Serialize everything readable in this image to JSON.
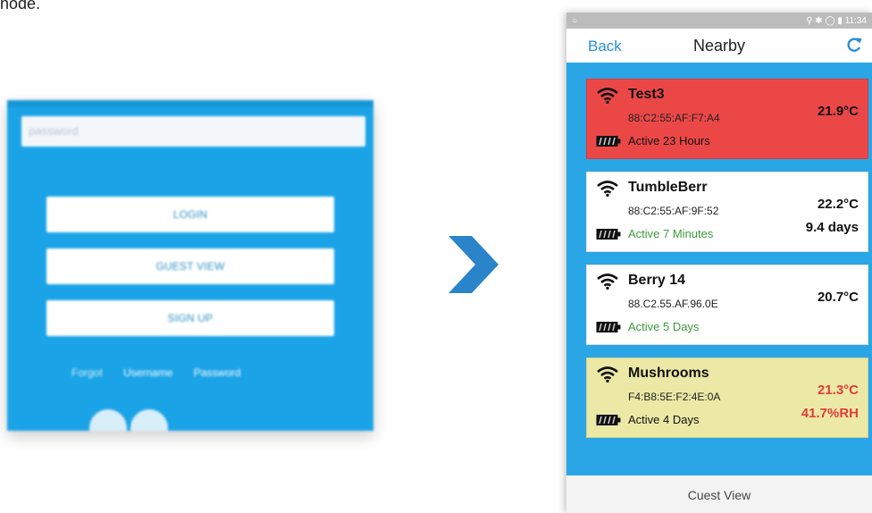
{
  "fragment": "node.",
  "login": {
    "password_placeholder": "password",
    "buttons": [
      "LOGIN",
      "GUEST VIEW",
      "SIGN UP"
    ],
    "forgot": "Forgot",
    "username_link": "Username",
    "password_link": "Password"
  },
  "phone": {
    "status_time": "11:34",
    "appbar": {
      "back": "Back",
      "title": "Nearby"
    },
    "devices": [
      {
        "name": "Test3",
        "mac": "88:C2:55:AF:F7:A4",
        "active": "Active 23 Hours",
        "temp": "21.9°C",
        "extra": "",
        "bg": "#ec4747",
        "active_color": "#111111",
        "temp_color": "#111111",
        "extra_color": "#111111"
      },
      {
        "name": "TumbleBerr",
        "mac": "88:C2:55:AF:9F:52",
        "active": "Active 7 Minutes",
        "temp": "22.2°C",
        "extra": "9.4 days",
        "bg": "#ffffff",
        "active_color": "#3e9a3e",
        "temp_color": "#111111",
        "extra_color": "#111111"
      },
      {
        "name": "Berry 14",
        "mac": "88.C2.55.AF.96.0E",
        "active": "Active 5 Days",
        "temp": "20.7°C",
        "extra": "",
        "bg": "#ffffff",
        "active_color": "#3e9a3e",
        "temp_color": "#111111",
        "extra_color": "#111111"
      },
      {
        "name": "Mushrooms",
        "mac": "F4:B8:5E:F2:4E:0A",
        "active": "Active 4 Days",
        "temp": "21.3°C",
        "extra": "41.7%RH",
        "bg": "#ebe9a5",
        "active_color": "#111111",
        "temp_color": "#e23b3b",
        "extra_color": "#e23b3b"
      }
    ],
    "guest_view": "Cuest View"
  }
}
